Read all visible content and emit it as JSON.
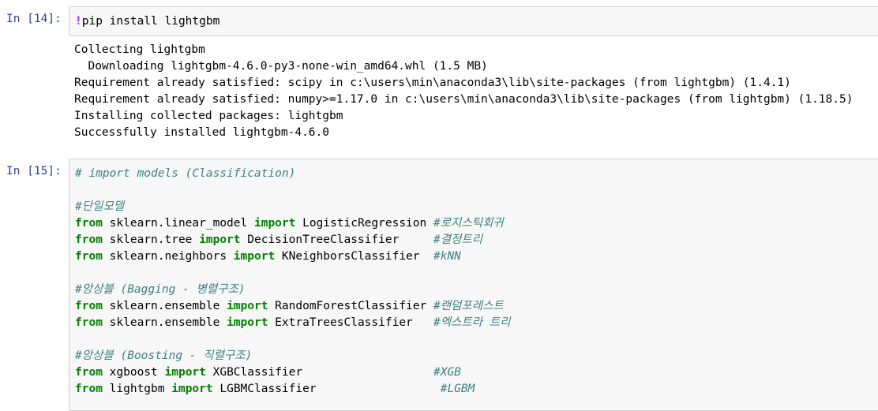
{
  "cell14": {
    "prompt": "In [14]:",
    "code_magic": "!",
    "code_rest": "pip install lightgbm",
    "output": [
      "Collecting lightgbm",
      "  Downloading lightgbm-4.6.0-py3-none-win_amd64.whl (1.5 MB)",
      "Requirement already satisfied: scipy in c:\\users\\min\\anaconda3\\lib\\site-packages (from lightgbm) (1.4.1)",
      "Requirement already satisfied: numpy>=1.17.0 in c:\\users\\min\\anaconda3\\lib\\site-packages (from lightgbm) (1.18.5)",
      "Installing collected packages: lightgbm",
      "Successfully installed lightgbm-4.6.0"
    ]
  },
  "cell15": {
    "prompt": "In [15]:",
    "lines": {
      "l1": {
        "comment": "# import models (Classification)"
      },
      "l3": {
        "comment": "#단일모델"
      },
      "l4": {
        "from": "from",
        "mod": " sklearn.linear_model ",
        "imp": "import",
        "cls": " LogisticRegression ",
        "comment": "#로지스틱회귀"
      },
      "l5": {
        "from": "from",
        "mod": " sklearn.tree ",
        "imp": "import",
        "cls": " DecisionTreeClassifier     ",
        "comment": "#결정트리"
      },
      "l6": {
        "from": "from",
        "mod": " sklearn.neighbors ",
        "imp": "import",
        "cls": " KNeighborsClassifier  ",
        "comment": "#kNN"
      },
      "l8": {
        "comment": "#앙상블 (Bagging - 병렬구조)"
      },
      "l9": {
        "from": "from",
        "mod": " sklearn.ensemble ",
        "imp": "import",
        "cls": " RandomForestClassifier ",
        "comment": "#랜덤포레스트"
      },
      "l10": {
        "from": "from",
        "mod": " sklearn.ensemble ",
        "imp": "import",
        "cls": " ExtraTreesClassifier   ",
        "comment": "#엑스트라 트리"
      },
      "l12": {
        "comment": "#앙상블 (Boosting - 직렬구조)"
      },
      "l13": {
        "from": "from",
        "mod": " xgboost ",
        "imp": "import",
        "cls": " XGBClassifier                   ",
        "comment": "#XGB"
      },
      "l14": {
        "from": "from",
        "mod": " lightgbm ",
        "imp": "import",
        "cls": " LGBMClassifier                  ",
        "comment": "#LGBM"
      }
    }
  },
  "colors": {
    "prompt": "#303f9f",
    "keyword": "#008000",
    "comment": "#408080",
    "magic": "#aa22ff",
    "cell_bg": "#f7f7f7",
    "cell_border": "#cfcfcf"
  }
}
